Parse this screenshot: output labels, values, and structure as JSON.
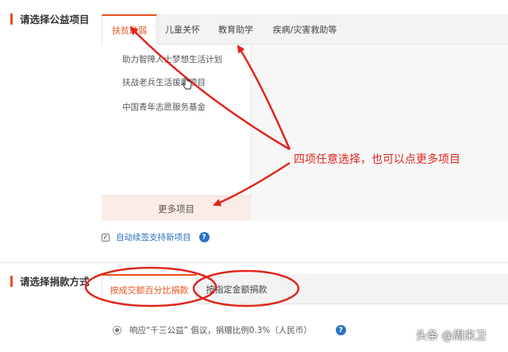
{
  "section1": {
    "title": "请选择公益项目"
  },
  "tabs": [
    {
      "label": "扶贫助弱",
      "active": true
    },
    {
      "label": "儿童关怀",
      "active": false
    },
    {
      "label": "教育助学",
      "active": false
    },
    {
      "label": "疾病/灾害救助等",
      "active": false
    }
  ],
  "projects": [
    {
      "label": "助力智障人士梦想生活计划"
    },
    {
      "label": "扶战老兵生活援助项目"
    },
    {
      "label": "中国青年志愿服务基金"
    }
  ],
  "more_button": "更多项目",
  "auto_renew": {
    "label": "自动续签支持新项目",
    "checked": true,
    "help_icon": "question-icon"
  },
  "section2": {
    "title": "请选择捐款方式"
  },
  "donation_tabs": [
    {
      "label": "按成交额百分比捐款",
      "active": true
    },
    {
      "label": "按指定金额捐款",
      "active": false
    }
  ],
  "donation_option": {
    "label": "响应“千三公益” 倡议，捐赠比例0.3%（人民币）",
    "selected": true,
    "help_icon": "question-icon"
  },
  "annotation": "四项任意选择，也可以点更多项目",
  "watermark": "头条 @周来卫",
  "colors": {
    "accent": "#e8531f",
    "link": "#2b6dc2",
    "annotation": "#e0261d",
    "help": "#2b73c9"
  }
}
